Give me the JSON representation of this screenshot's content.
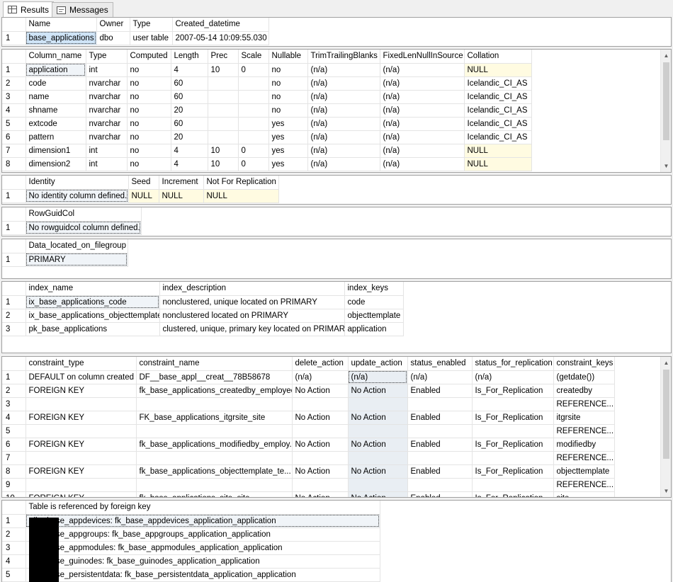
{
  "tabs": [
    {
      "label": "Results",
      "icon": "grid-icon",
      "active": true
    },
    {
      "label": "Messages",
      "icon": "messages-icon",
      "active": false
    }
  ],
  "object_info": {
    "headers": [
      "Name",
      "Owner",
      "Type",
      "Created_datetime"
    ],
    "rows": [
      [
        "1",
        "base_applications",
        "dbo",
        "user table",
        "2007-05-14 10:09:55.030"
      ]
    ]
  },
  "columns": {
    "headers": [
      "Column_name",
      "Type",
      "Computed",
      "Length",
      "Prec",
      "Scale",
      "Nullable",
      "TrimTrailingBlanks",
      "FixedLenNullInSource",
      "Collation"
    ],
    "rows": [
      [
        "1",
        "application",
        "int",
        "no",
        "4",
        "10",
        "0",
        "no",
        "(n/a)",
        "(n/a)",
        "NULL"
      ],
      [
        "2",
        "code",
        "nvarchar",
        "no",
        "60",
        "",
        "",
        "no",
        "(n/a)",
        "(n/a)",
        "Icelandic_CI_AS"
      ],
      [
        "3",
        "name",
        "nvarchar",
        "no",
        "60",
        "",
        "",
        "no",
        "(n/a)",
        "(n/a)",
        "Icelandic_CI_AS"
      ],
      [
        "4",
        "shname",
        "nvarchar",
        "no",
        "20",
        "",
        "",
        "no",
        "(n/a)",
        "(n/a)",
        "Icelandic_CI_AS"
      ],
      [
        "5",
        "extcode",
        "nvarchar",
        "no",
        "60",
        "",
        "",
        "yes",
        "(n/a)",
        "(n/a)",
        "Icelandic_CI_AS"
      ],
      [
        "6",
        "pattern",
        "nvarchar",
        "no",
        "20",
        "",
        "",
        "yes",
        "(n/a)",
        "(n/a)",
        "Icelandic_CI_AS"
      ],
      [
        "7",
        "dimension1",
        "int",
        "no",
        "4",
        "10",
        "0",
        "yes",
        "(n/a)",
        "(n/a)",
        "NULL"
      ],
      [
        "8",
        "dimension2",
        "int",
        "no",
        "4",
        "10",
        "0",
        "yes",
        "(n/a)",
        "(n/a)",
        "NULL"
      ]
    ]
  },
  "identity": {
    "headers": [
      "Identity",
      "Seed",
      "Increment",
      "Not For Replication"
    ],
    "rows": [
      [
        "1",
        "No identity column defined.",
        "NULL",
        "NULL",
        "NULL"
      ]
    ]
  },
  "rowguid": {
    "headers": [
      "RowGuidCol"
    ],
    "rows": [
      [
        "1",
        "No rowguidcol column defined."
      ]
    ]
  },
  "filegroup": {
    "headers": [
      "Data_located_on_filegroup"
    ],
    "rows": [
      [
        "1",
        "PRIMARY"
      ]
    ]
  },
  "indexes": {
    "headers": [
      "index_name",
      "index_description",
      "index_keys"
    ],
    "rows": [
      [
        "1",
        "ix_base_applications_code",
        "nonclustered, unique located on PRIMARY",
        "code"
      ],
      [
        "2",
        "ix_base_applications_objecttemplate",
        "nonclustered located on PRIMARY",
        "objecttemplate"
      ],
      [
        "3",
        "pk_base_applications",
        "clustered, unique, primary key located on PRIMARY",
        "application"
      ]
    ]
  },
  "constraints": {
    "headers": [
      "constraint_type",
      "constraint_name",
      "delete_action",
      "update_action",
      "status_enabled",
      "status_for_replication",
      "constraint_keys"
    ],
    "rows": [
      [
        "1",
        "DEFAULT on column created",
        "DF__base_appl__creat__78B58678",
        "(n/a)",
        "(n/a)",
        "(n/a)",
        "(n/a)",
        "(getdate())"
      ],
      [
        "2",
        "FOREIGN KEY",
        "fk_base_applications_createdby_employee",
        "No Action",
        "No Action",
        "Enabled",
        "Is_For_Replication",
        "createdby"
      ],
      [
        "3",
        "",
        "",
        "",
        "",
        "",
        "",
        "REFERENCE..."
      ],
      [
        "4",
        "FOREIGN KEY",
        "FK_base_applications_itgrsite_site",
        "No Action",
        "No Action",
        "Enabled",
        "Is_For_Replication",
        "itgrsite"
      ],
      [
        "5",
        "",
        "",
        "",
        "",
        "",
        "",
        "REFERENCE..."
      ],
      [
        "6",
        "FOREIGN KEY",
        "fk_base_applications_modifiedby_employ...",
        "No Action",
        "No Action",
        "Enabled",
        "Is_For_Replication",
        "modifiedby"
      ],
      [
        "7",
        "",
        "",
        "",
        "",
        "",
        "",
        "REFERENCE..."
      ],
      [
        "8",
        "FOREIGN KEY",
        "fk_base_applications_objecttemplate_te...",
        "No Action",
        "No Action",
        "Enabled",
        "Is_For_Replication",
        "objecttemplate"
      ],
      [
        "9",
        "",
        "",
        "",
        "",
        "",
        "",
        "REFERENCE..."
      ],
      [
        "10",
        "FOREIGN KEY",
        "fk_base_applications_site_site",
        "No Action",
        "No Action",
        "Enabled",
        "Is_For_Replication",
        "site"
      ]
    ]
  },
  "references": {
    "headers": [
      "Table is referenced by foreign key"
    ],
    "rows": [
      [
        "1",
        ".dbo.base_appdevices: fk_base_appdevices_application_application"
      ],
      [
        "2",
        ".dbo.base_appgroups: fk_base_appgroups_application_application"
      ],
      [
        "3",
        ".dbo.base_appmodules: fk_base_appmodules_application_application"
      ],
      [
        "4",
        ".dbo.base_guinodes: fk_base_guinodes_application_application"
      ],
      [
        "5",
        ".dbo.base_persistentdata: fk_base_persistentdata_application_application"
      ]
    ]
  },
  "colors": {
    "null_cell": "#fffbe1",
    "selected_cell": "#cfe4f7",
    "selected_column": "#e9eef3"
  }
}
